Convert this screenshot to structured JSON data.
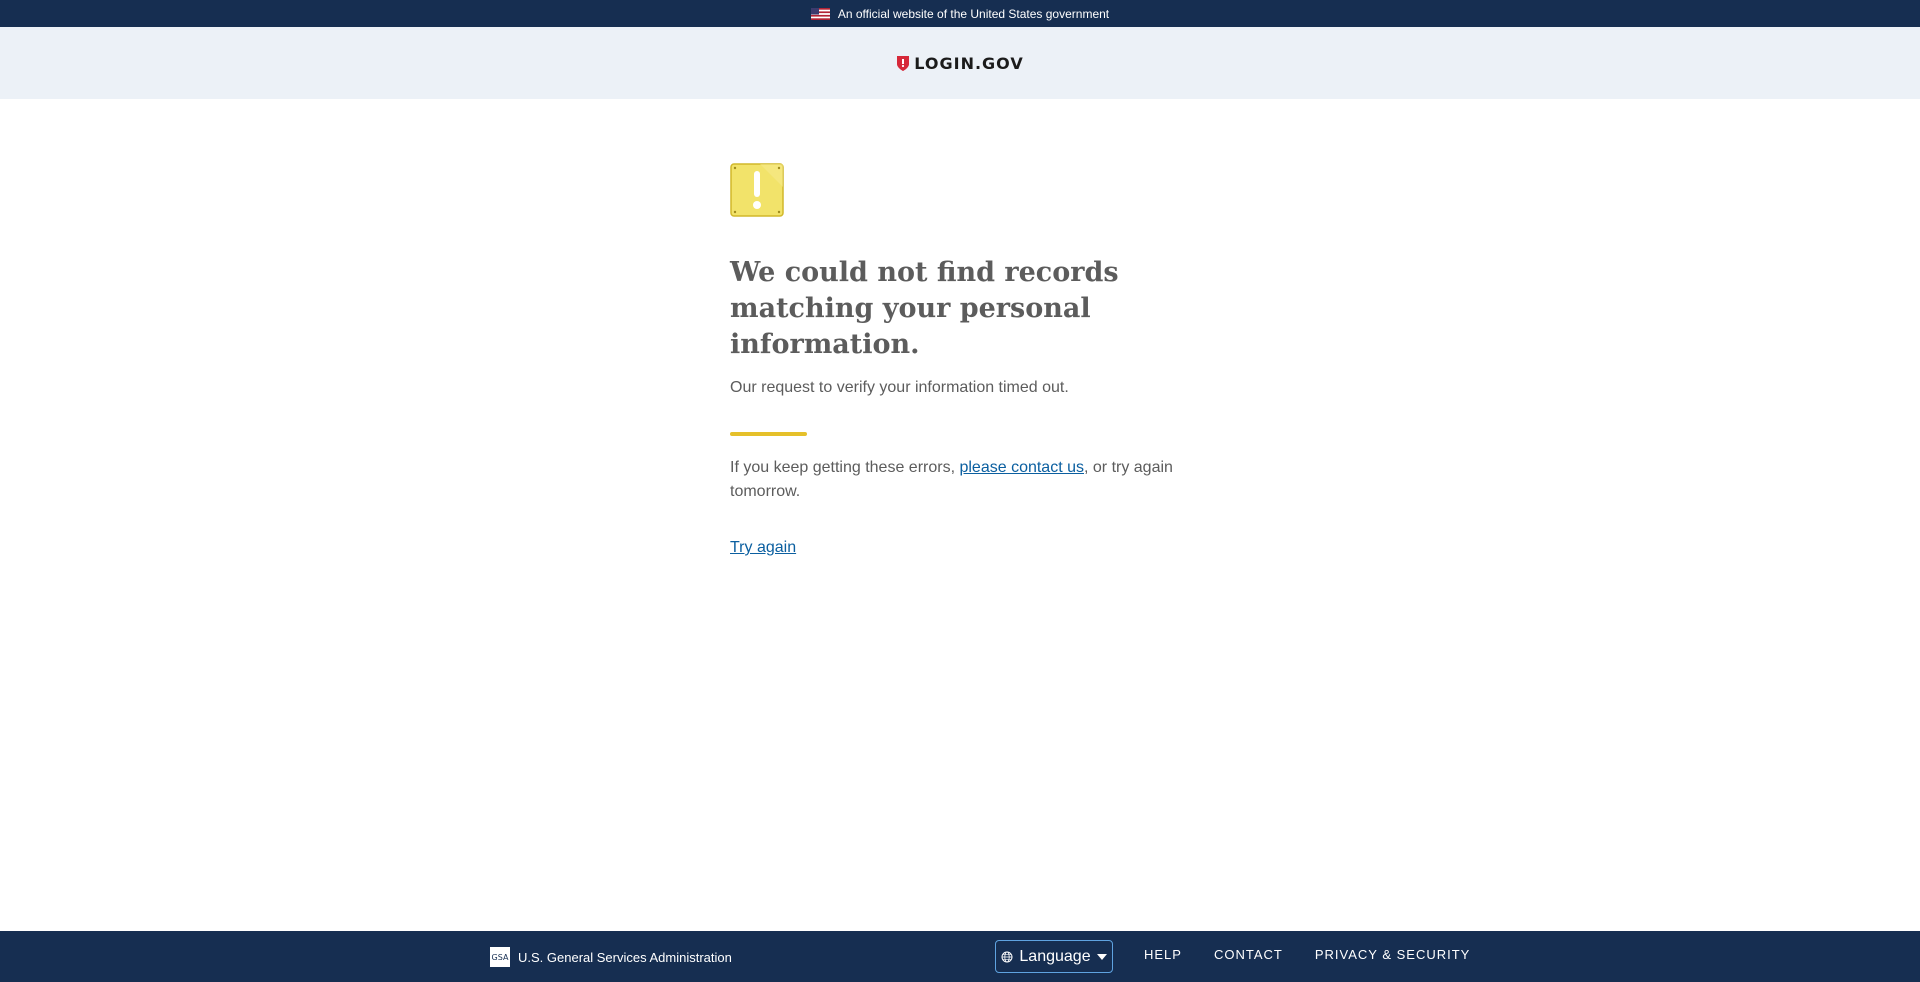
{
  "gov_banner": {
    "text": "An official website of the United States government"
  },
  "header": {
    "logo_text": "LOGIN.GOV"
  },
  "main": {
    "heading": "We could not find records matching your personal information.",
    "lead": "Our request to verify your information timed out.",
    "help_prefix": "If you keep getting these errors, ",
    "help_link": "please contact us",
    "help_suffix": ", or try again tomorrow.",
    "try_again": "Try again"
  },
  "footer": {
    "agency": "U.S. General Services Administration",
    "gsa_logo_text": "GSA",
    "language_label": "Language",
    "links": [
      "HELP",
      "CONTACT",
      "PRIVACY & SECURITY"
    ]
  },
  "colors": {
    "banner_bg": "#162e51",
    "header_bg": "#ecf1f7",
    "accent_gold": "#e5c02a",
    "link": "#0b5fa0",
    "shield_red": "#d62839"
  },
  "icons": [
    "us-flag-icon",
    "login-shield-icon",
    "warning-icon",
    "gsa-logo-icon",
    "globe-icon",
    "caret-down-icon"
  ]
}
